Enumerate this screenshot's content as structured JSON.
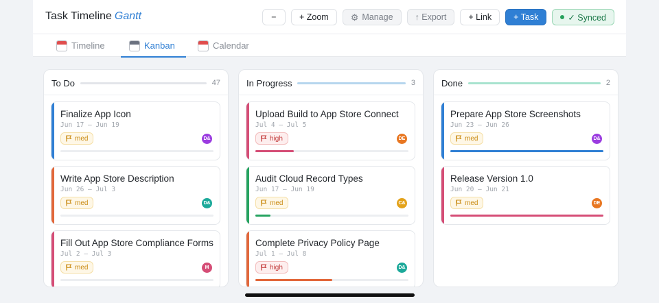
{
  "app": {
    "title": "Task Timeline",
    "title_accent": "Gantt"
  },
  "toolbar": {
    "zoom_out_label": "−",
    "zoom_in_label": "+ Zoom",
    "manage_label": "Manage",
    "export_label": "↑ Export",
    "link_label": "+ Link",
    "task_label": "+ Task",
    "synced_label": "✓ Synced"
  },
  "tabs": [
    {
      "label": "Timeline",
      "icon": "calendar-icon",
      "active": false
    },
    {
      "label": "Kanban",
      "icon": "kanban-icon",
      "active": true
    },
    {
      "label": "Calendar",
      "icon": "calendar-icon",
      "active": false
    }
  ],
  "colors": {
    "accent": "#2f7fd4",
    "blue": "#2f7fd4",
    "orange": "#e2673a",
    "pink": "#d54d76",
    "green": "#25a35f"
  },
  "columns": [
    {
      "title": "To Do",
      "count": "47",
      "line_color": "#e3e5ea",
      "cards": [
        {
          "title": "Finalize App Icon",
          "dates": "Jun 17 — Jun 19",
          "priority": "med",
          "assignee": "D&",
          "avatar_color": "#9b3ce0",
          "bar_color": "#2f7fd4",
          "progress": 0,
          "progress_color": "#2f7fd4"
        },
        {
          "title": "Write App Store Description",
          "dates": "Jun 26 — Jul 3",
          "priority": "med",
          "assignee": "D&",
          "avatar_color": "#1ca99a",
          "bar_color": "#e2673a",
          "progress": 0,
          "progress_color": "#e2673a"
        },
        {
          "title": "Fill Out App Store Compliance Forms",
          "dates": "Jul 2 — Jul 3",
          "priority": "med",
          "assignee": "M",
          "avatar_color": "#d54d76",
          "bar_color": "#d54d76",
          "progress": 0,
          "progress_color": "#d54d76"
        }
      ]
    },
    {
      "title": "In Progress",
      "count": "3",
      "line_color": "#b6d6ee",
      "cards": [
        {
          "title": "Upload Build to App Store Connect",
          "dates": "Jul 4 — Jul 5",
          "priority": "high",
          "assignee": "DE",
          "avatar_color": "#e87722",
          "bar_color": "#d54d76",
          "progress": 0.25,
          "progress_color": "#d54d76"
        },
        {
          "title": "Audit Cloud Record Types",
          "dates": "Jun 17 — Jun 19",
          "priority": "med",
          "assignee": "C&",
          "avatar_color": "#e3a21a",
          "bar_color": "#25a35f",
          "progress": 0.1,
          "progress_color": "#25a35f"
        },
        {
          "title": "Complete Privacy Policy Page",
          "dates": "Jul 1 — Jul 8",
          "priority": "high",
          "assignee": "D&",
          "avatar_color": "#1ca99a",
          "bar_color": "#e2673a",
          "progress": 0.5,
          "progress_color": "#e2673a"
        }
      ]
    },
    {
      "title": "Done",
      "count": "2",
      "line_color": "#a8e3cf",
      "cards": [
        {
          "title": "Prepare App Store Screenshots",
          "dates": "Jun 23 — Jun 26",
          "priority": "med",
          "assignee": "D&",
          "avatar_color": "#9b3ce0",
          "bar_color": "#2f7fd4",
          "progress": 1,
          "progress_color": "#2f7fd4"
        },
        {
          "title": "Release Version 1.0",
          "dates": "Jun 20 — Jun 21",
          "priority": "med",
          "assignee": "DE",
          "avatar_color": "#e87722",
          "bar_color": "#d54d76",
          "progress": 1,
          "progress_color": "#d54d76"
        }
      ]
    }
  ]
}
